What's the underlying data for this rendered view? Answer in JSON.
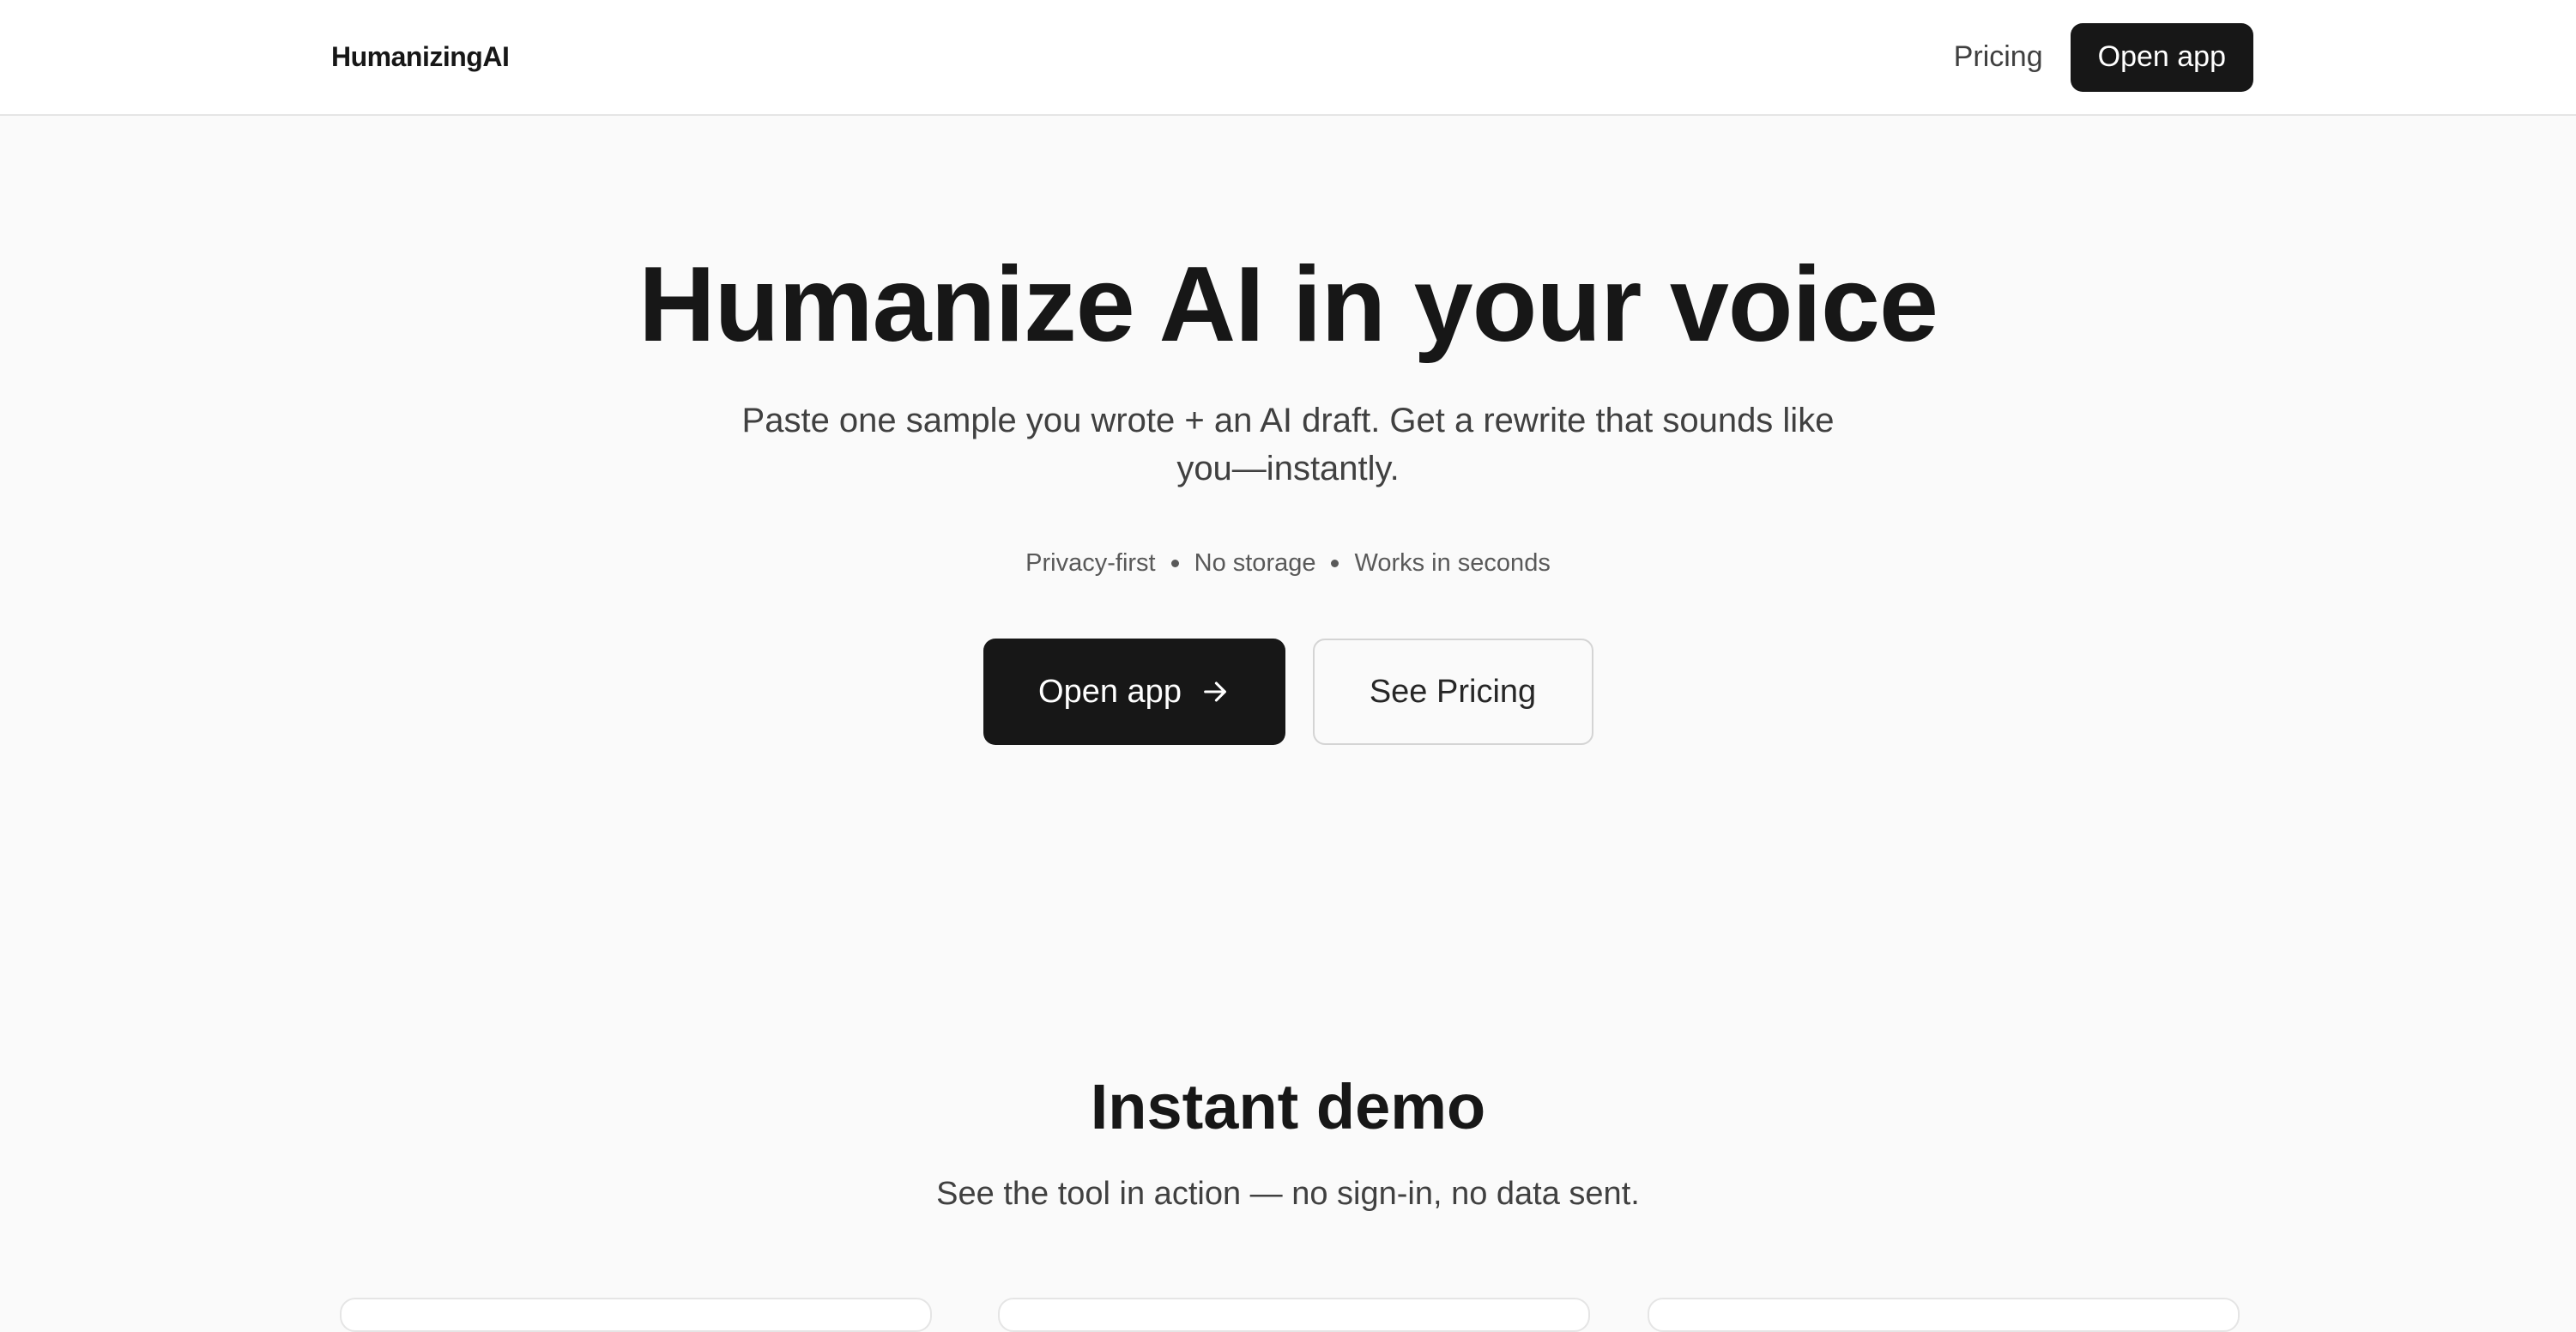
{
  "header": {
    "brand": "HumanizingAI",
    "nav_pricing": "Pricing",
    "nav_open_app": "Open app"
  },
  "hero": {
    "title": "Humanize AI in your voice",
    "subtitle": "Paste one sample you wrote + an AI draft. Get a rewrite that sounds like you—instantly.",
    "features": [
      "Privacy-first",
      "No storage",
      "Works in seconds"
    ],
    "cta_primary": "Open app",
    "cta_secondary": "See Pricing"
  },
  "demo": {
    "title": "Instant demo",
    "subtitle": "See the tool in action — no sign-in, no data sent."
  },
  "colors": {
    "primary": "#171717",
    "background": "#fafafa",
    "header_background": "#ffffff"
  },
  "icons": {
    "cta_primary": "arrow-right-icon"
  }
}
